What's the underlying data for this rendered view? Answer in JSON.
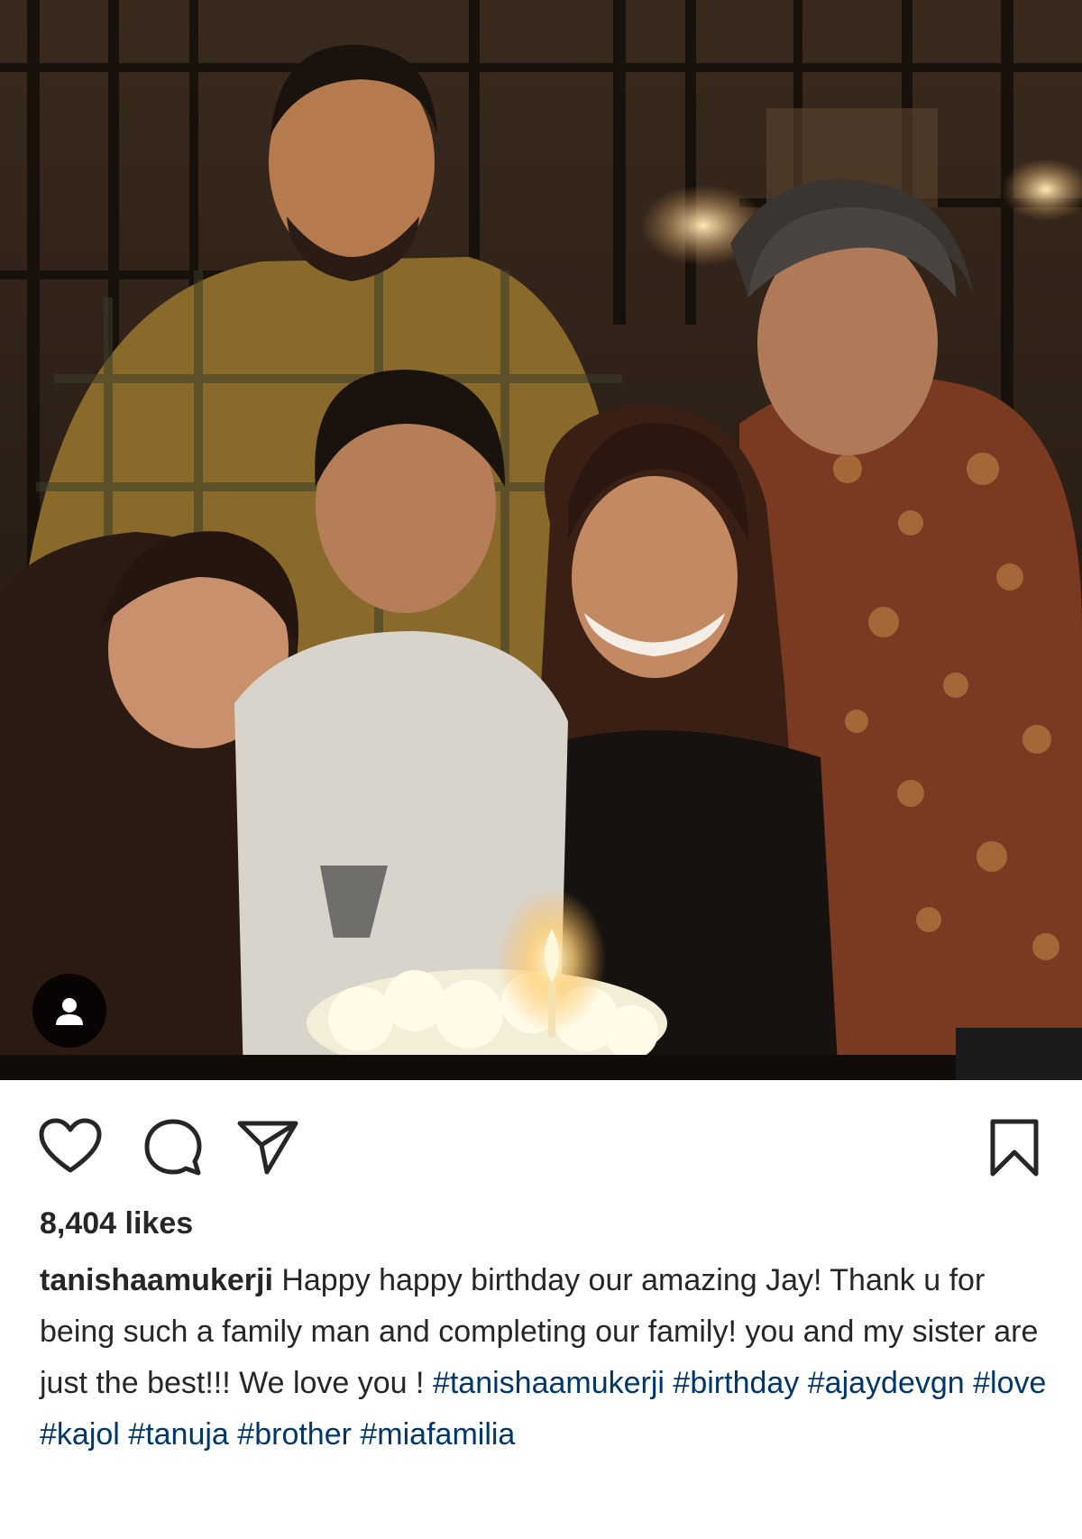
{
  "post": {
    "photo_alt": "family-birthday-photo",
    "tag_icon": "person-icon",
    "actions": {
      "like_icon": "heart-icon",
      "comment_icon": "comment-icon",
      "share_icon": "send-icon",
      "save_icon": "bookmark-icon"
    },
    "likes_text": "8,404 likes",
    "caption": {
      "username": "tanishaamukerji",
      "text": "Happy happy birthday our amazing Jay! Thank u for being such a family man and completing our family! you and my sister are just the best!!! We love you ! ",
      "hashtags": [
        "#tanishaamukerji",
        "#birthday",
        "#ajaydevgn",
        "#love",
        "#kajol",
        "#tanuja",
        "#brother",
        "#miafamilia"
      ]
    }
  },
  "colors": {
    "text": "#262626",
    "hashtag": "#00376b",
    "background": "#ffffff"
  }
}
